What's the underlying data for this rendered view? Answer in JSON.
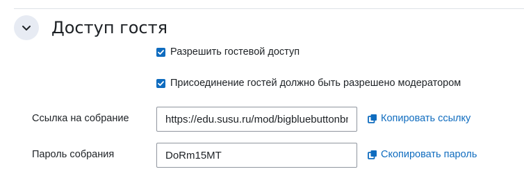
{
  "section": {
    "title": "Доступ гостя",
    "toggle_icon": "chevron-down-icon"
  },
  "options": {
    "guest_access_label": "Разрешить гостевой доступ",
    "guest_access_checked": true,
    "moderator_approval_label": "Присоединение гостей должно быть разрешено модератором",
    "moderator_approval_checked": true
  },
  "meeting_link": {
    "label": "Ссылка на собрание",
    "value": "https://edu.susu.ru/mod/bigbluebuttonbn/",
    "copy_label": "Копировать ссылку",
    "copy_icon": "copy-icon"
  },
  "meeting_password": {
    "label": "Пароль собрания",
    "value": "DoRm15MT",
    "copy_label": "Скопировать пароль",
    "copy_icon": "copy-icon"
  },
  "colors": {
    "accent": "#0f6cbf",
    "toggle_bg": "#e7ebf3",
    "text": "#1d2125",
    "input_border": "#8f959e"
  }
}
